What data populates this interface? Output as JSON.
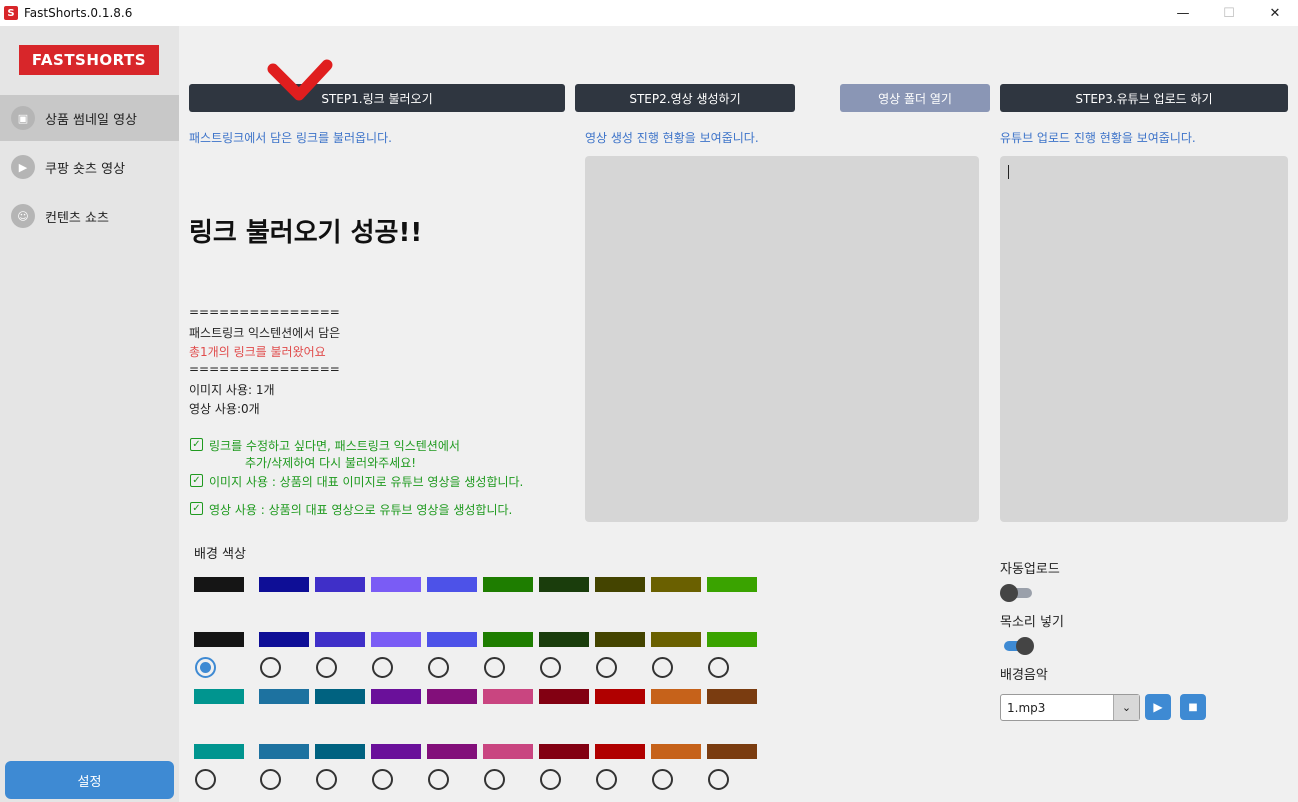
{
  "window": {
    "title": "FastShorts.0.1.8.6",
    "app_icon_glyph": "S",
    "minimize": "—",
    "maximize": "☐",
    "close": "✕"
  },
  "sidebar": {
    "logo_text": "FASTSHORTS",
    "items": [
      {
        "label": "상품 썸네일 영상",
        "icon": "shopping-bag-icon",
        "glyph": "▣"
      },
      {
        "label": "쿠팡 숏츠 영상",
        "icon": "play-icon",
        "glyph": "▶"
      },
      {
        "label": "컨텐츠 쇼츠",
        "icon": "smile-icon",
        "glyph": "☺"
      }
    ],
    "settings_label": "설정"
  },
  "toolbar": {
    "step1": "STEP1.링크 불러오기",
    "step2": "STEP2.영상 생성하기",
    "open_folder": "영상 폴더 열기",
    "step3": "STEP3.유튜브 업로드 하기"
  },
  "hints": {
    "step1": "패스트링크에서 담은 링크를 불러옵니다.",
    "step2": "영상 생성 진행 현황을 보여줍니다.",
    "step3": "유튜브 업로드 진행 현황을 보여줍니다."
  },
  "status": {
    "title": "링크 불러오기 성공!!",
    "divider1": "===============",
    "line1": "패스트링크 익스텐션에서 담은",
    "line2": "총1개의 링크를 불러왔어요",
    "divider2": "===============",
    "image_use": "이미지 사용: 1개",
    "video_use": "영상 사용:0개"
  },
  "checks": [
    {
      "text": "링크를 수정하고 싶다면, 패스트링크 익스텐션에서",
      "sub": "추가/삭제하여 다시 불러와주세요!"
    },
    {
      "text": "이미지 사용 : 상품의 대표 이미지로 유튜브 영상을 생성합니다.",
      "sub": ""
    },
    {
      "text": "영상 사용 : 상품의 대표 영상으로 유튜브 영상을 생성합니다.",
      "sub": ""
    }
  ],
  "colors": {
    "label": "배경 색상",
    "row1": [
      "#151515",
      "#0e0e96",
      "#3f2fc8",
      "#7a5cf5",
      "#4d52e8",
      "#1e7d00",
      "#1a3d0c",
      "#444400",
      "#6a6000",
      "#3aa300"
    ],
    "row2": [
      "#00958f",
      "#1d72a0",
      "#006280",
      "#6a109a",
      "#820f7a",
      "#c94580",
      "#820012",
      "#b00000",
      "#c6621a",
      "#7a3c10"
    ],
    "selected_index": 0
  },
  "options": {
    "auto_upload_label": "자동업로드",
    "auto_upload_on": false,
    "voice_label": "목소리 넣기",
    "voice_on": true,
    "bgm_label": "배경음악",
    "bgm_value": "1.mp3",
    "play_glyph": "▶",
    "stop_glyph": "■"
  }
}
